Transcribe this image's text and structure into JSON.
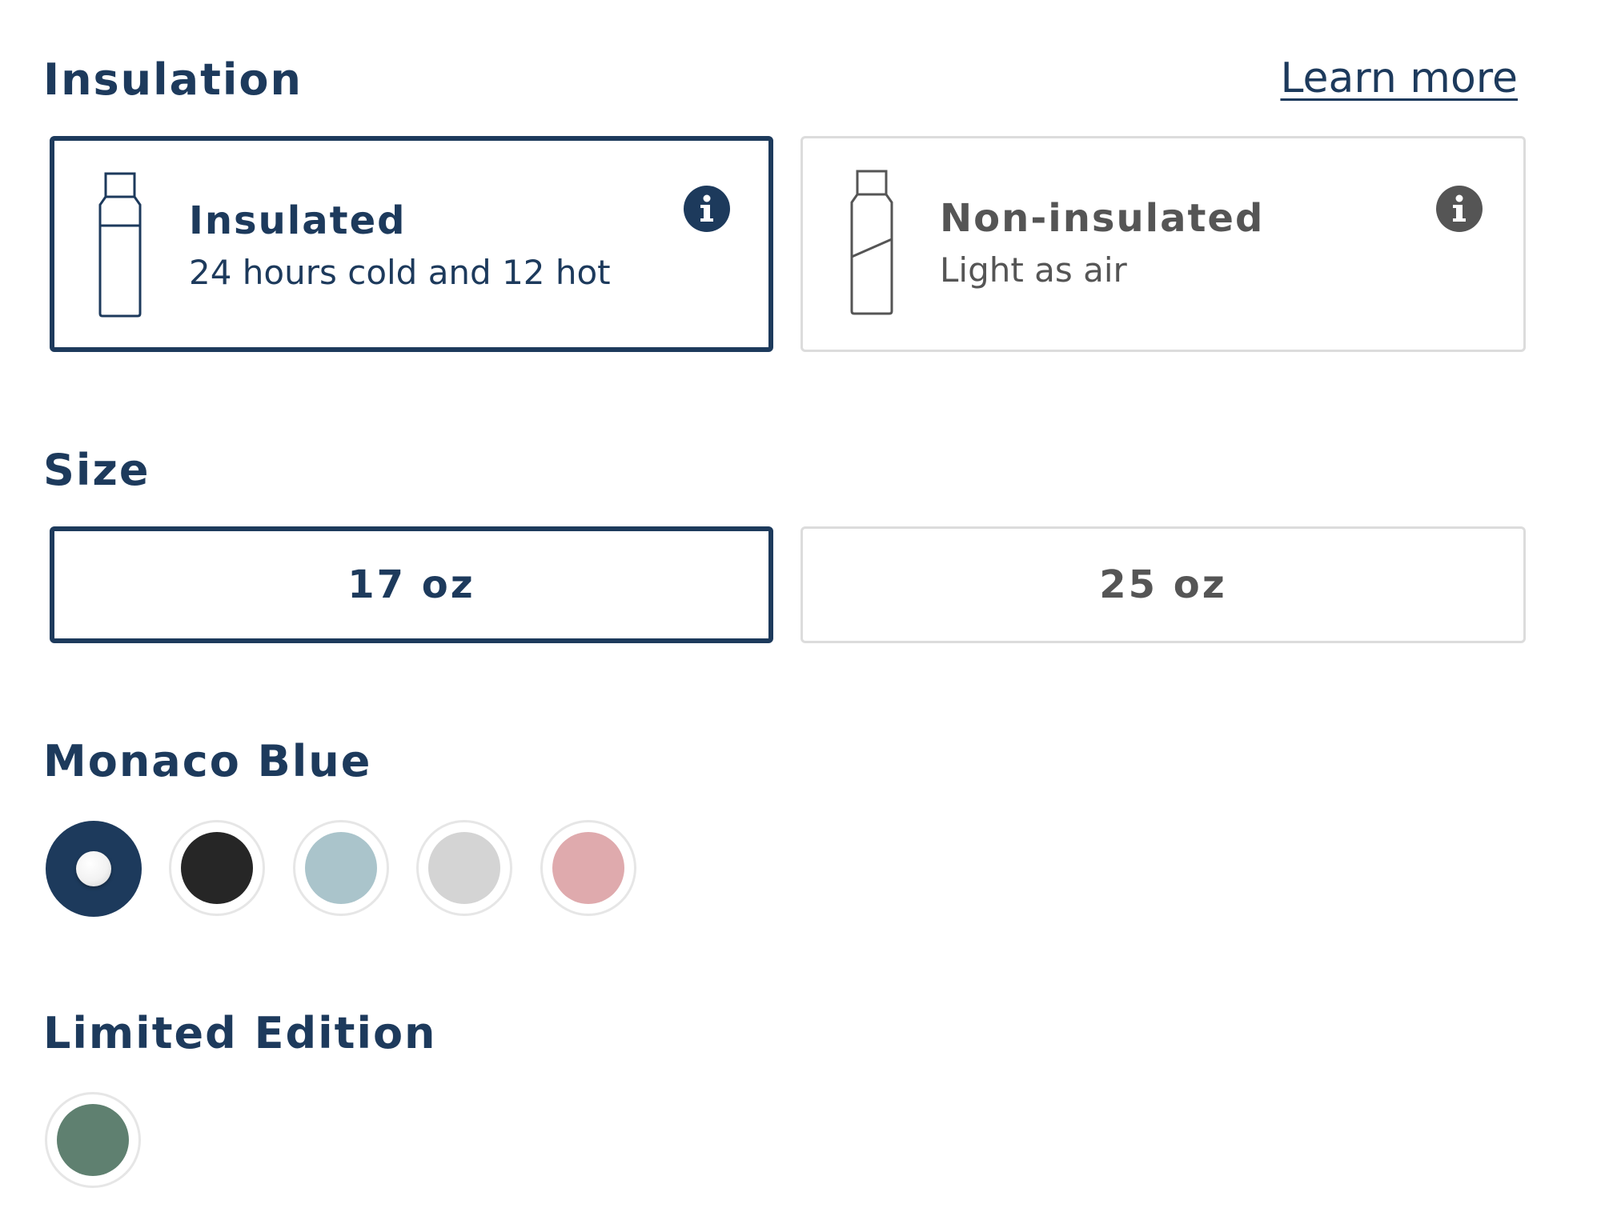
{
  "insulation": {
    "title": "Insulation",
    "learn_more": "Learn more",
    "options": [
      {
        "title": "Insulated",
        "subtitle": "24 hours cold and 12 hot",
        "selected": true
      },
      {
        "title": "Non-insulated",
        "subtitle": "Light as air",
        "selected": false
      }
    ]
  },
  "size": {
    "title": "Size",
    "options": [
      {
        "label": "17 oz",
        "selected": true
      },
      {
        "label": "25 oz",
        "selected": false
      }
    ]
  },
  "color": {
    "title": "Monaco Blue",
    "swatches": [
      {
        "color": "#1d3a5c",
        "selected": true
      },
      {
        "color": "#262626",
        "selected": false
      },
      {
        "color": "#aac4cb",
        "selected": false
      },
      {
        "color": "#d4d4d4",
        "selected": false
      },
      {
        "color": "#dfaaad",
        "selected": false
      }
    ]
  },
  "limited": {
    "title": "Limited Edition",
    "swatches": [
      {
        "color": "#5f8070",
        "selected": false
      }
    ]
  },
  "colors": {
    "primary": "#1d3a5c",
    "muted_text": "#555555",
    "border_light": "#dcdcdc"
  },
  "icons": [
    "bottle-insulated-icon",
    "bottle-non-insulated-icon",
    "info-icon"
  ]
}
